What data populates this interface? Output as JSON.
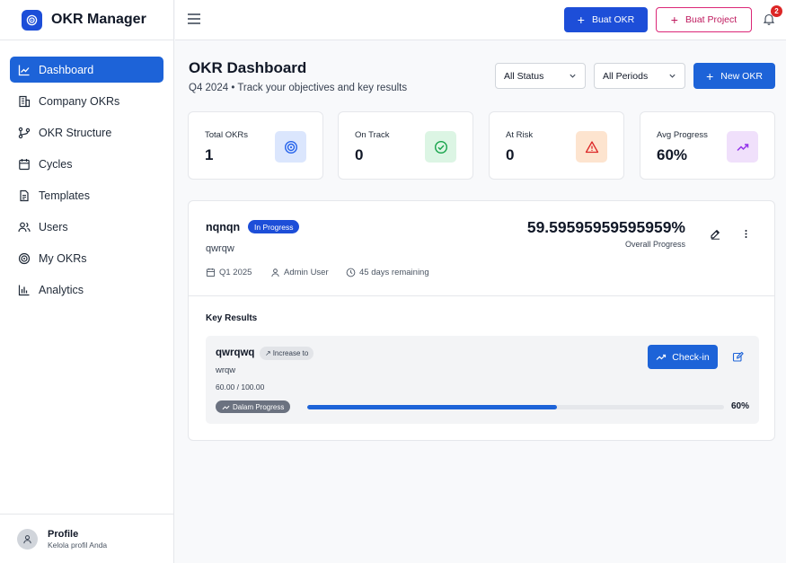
{
  "app": {
    "title": "OKR Manager"
  },
  "sidebar": {
    "items": [
      {
        "label": "Dashboard",
        "icon": "chart-line-icon",
        "active": true
      },
      {
        "label": "Company OKRs",
        "icon": "building-icon"
      },
      {
        "label": "OKR Structure",
        "icon": "structure-icon"
      },
      {
        "label": "Cycles",
        "icon": "calendar-icon"
      },
      {
        "label": "Templates",
        "icon": "document-icon"
      },
      {
        "label": "Users",
        "icon": "users-icon"
      },
      {
        "label": "My OKRs",
        "icon": "target-icon"
      },
      {
        "label": "Analytics",
        "icon": "bar-chart-icon"
      }
    ],
    "profile": {
      "name": "Profile",
      "subtitle": "Kelola profil Anda"
    }
  },
  "topbar": {
    "buat_okr": "Buat OKR",
    "buat_project": "Buat Project",
    "notification_count": "2"
  },
  "header": {
    "title": "OKR Dashboard",
    "subtitle": "Q4 2024 • Track your objectives and key results",
    "status_filter": "All Status",
    "period_filter": "All Periods",
    "new_okr": "New OKR"
  },
  "stats": [
    {
      "label": "Total OKRs",
      "value": "1",
      "icon": "target-icon",
      "color": "#dbe6fd",
      "icon_color": "#2563eb"
    },
    {
      "label": "On Track",
      "value": "0",
      "icon": "check-circle-icon",
      "color": "#dcf5e4",
      "icon_color": "#16a34a"
    },
    {
      "label": "At Risk",
      "value": "0",
      "icon": "warning-icon",
      "color": "#fde4cf",
      "icon_color": "#dc2626"
    },
    {
      "label": "Avg Progress",
      "value": "60%",
      "icon": "trending-up-icon",
      "color": "#f0e0fb",
      "icon_color": "#9333ea"
    }
  ],
  "okr": {
    "title": "nqnqn",
    "status": "In Progress",
    "description": "qwrqw",
    "period": "Q1 2025",
    "owner": "Admin User",
    "remaining": "45 days remaining",
    "progress": "59.59595959595959%",
    "progress_label": "Overall Progress",
    "key_results_heading": "Key Results",
    "key_results": [
      {
        "title": "qwrqwq",
        "type": "Increase to",
        "description": "wrqw",
        "value_text": "60.00 / 100.00",
        "status": "Dalam Progress",
        "progress": 0.6,
        "progress_text": "60%",
        "checkin_label": "Check-in"
      }
    ]
  },
  "colors": {
    "primary": "#1d4ed8",
    "accent_pink": "#db2777",
    "badge_red": "#dc2626"
  }
}
